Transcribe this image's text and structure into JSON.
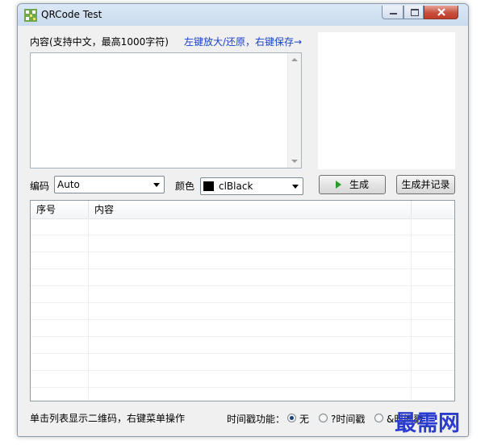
{
  "window": {
    "title": "QRCode Test"
  },
  "content": {
    "label": "内容(支持中文，最高1000字符)",
    "hint": "左键放大/还原，右键保存→",
    "text": ""
  },
  "encoding": {
    "label": "编码",
    "value": "Auto"
  },
  "color": {
    "label": "颜色",
    "value": "clBlack",
    "swatch": "#000000"
  },
  "buttons": {
    "generate": "生成",
    "generate_record": "生成并记录"
  },
  "list": {
    "columns": [
      "序号",
      "内容"
    ],
    "rows": []
  },
  "status": {
    "hint": "单击列表显示二维码，右键菜单操作",
    "timestamp_label": "时间戳功能：",
    "options": [
      "无",
      "?时间戳",
      "&时间戳"
    ],
    "selected": "无"
  },
  "watermark": "最需网"
}
